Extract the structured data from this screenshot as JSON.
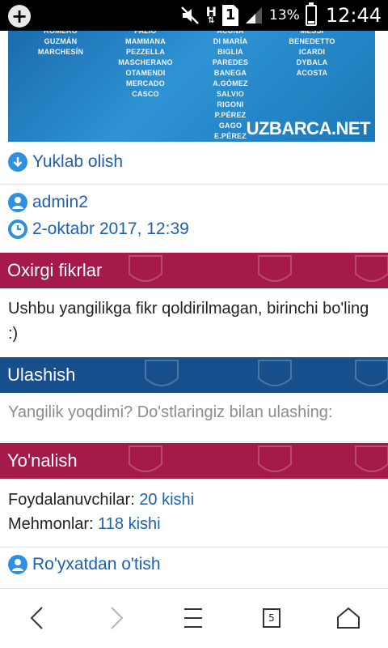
{
  "status_bar": {
    "battery_percent": "13%",
    "battery_level": 0.13,
    "time": "12:44",
    "sim_label": "1",
    "network_label": "H"
  },
  "banner": {
    "col1": [
      "ROMERO",
      "GUZMÁN",
      "MARCHESÍN"
    ],
    "col2": [
      "FAZIO",
      "MAMMANA",
      "PEZZELLA",
      "MASCHERANO",
      "OTAMENDI",
      "MERCADO",
      "CASCO"
    ],
    "col3": [
      "ACUÑA",
      "DI MARÍA",
      "BIGLIA",
      "PAREDES",
      "BANEGA",
      "A.GÓMEZ",
      "SALVIO",
      "RIGONI",
      "P.PÉREZ",
      "GAGO",
      "E.PÉREZ"
    ],
    "col4": [
      "MESSI",
      "BENEDETTO",
      "ICARDI",
      "DYBALA",
      "ACOSTA"
    ],
    "logo": "UZBARCA.NET"
  },
  "download": {
    "label": "Yuklab olish",
    "icon": "download-icon"
  },
  "meta": {
    "author": "admin2",
    "date": "2-oktabr 2017, 12:39"
  },
  "comments": {
    "title": "Oxirgi fikrlar",
    "text": "Ushbu yangilikga fikr qoldirilmagan, birinchi bo'ling :)"
  },
  "share": {
    "title": "Ulashish",
    "text": "Yangilik yoqdimi? Do'stlaringiz bilan ulashing:"
  },
  "direction": {
    "title": "Yo'nalish",
    "users_label": "Foydalanuvchilar:",
    "users_value": "20 kishi",
    "guests_label": "Mehmonlar:",
    "guests_value": "118 kishi"
  },
  "register": {
    "label": "Ro'yxatdan o'tish"
  },
  "nav": {
    "tab_count": "5"
  },
  "colors": {
    "accent_red": "#a51a4b",
    "accent_blue": "#174f8c",
    "link": "#1e5fae"
  }
}
